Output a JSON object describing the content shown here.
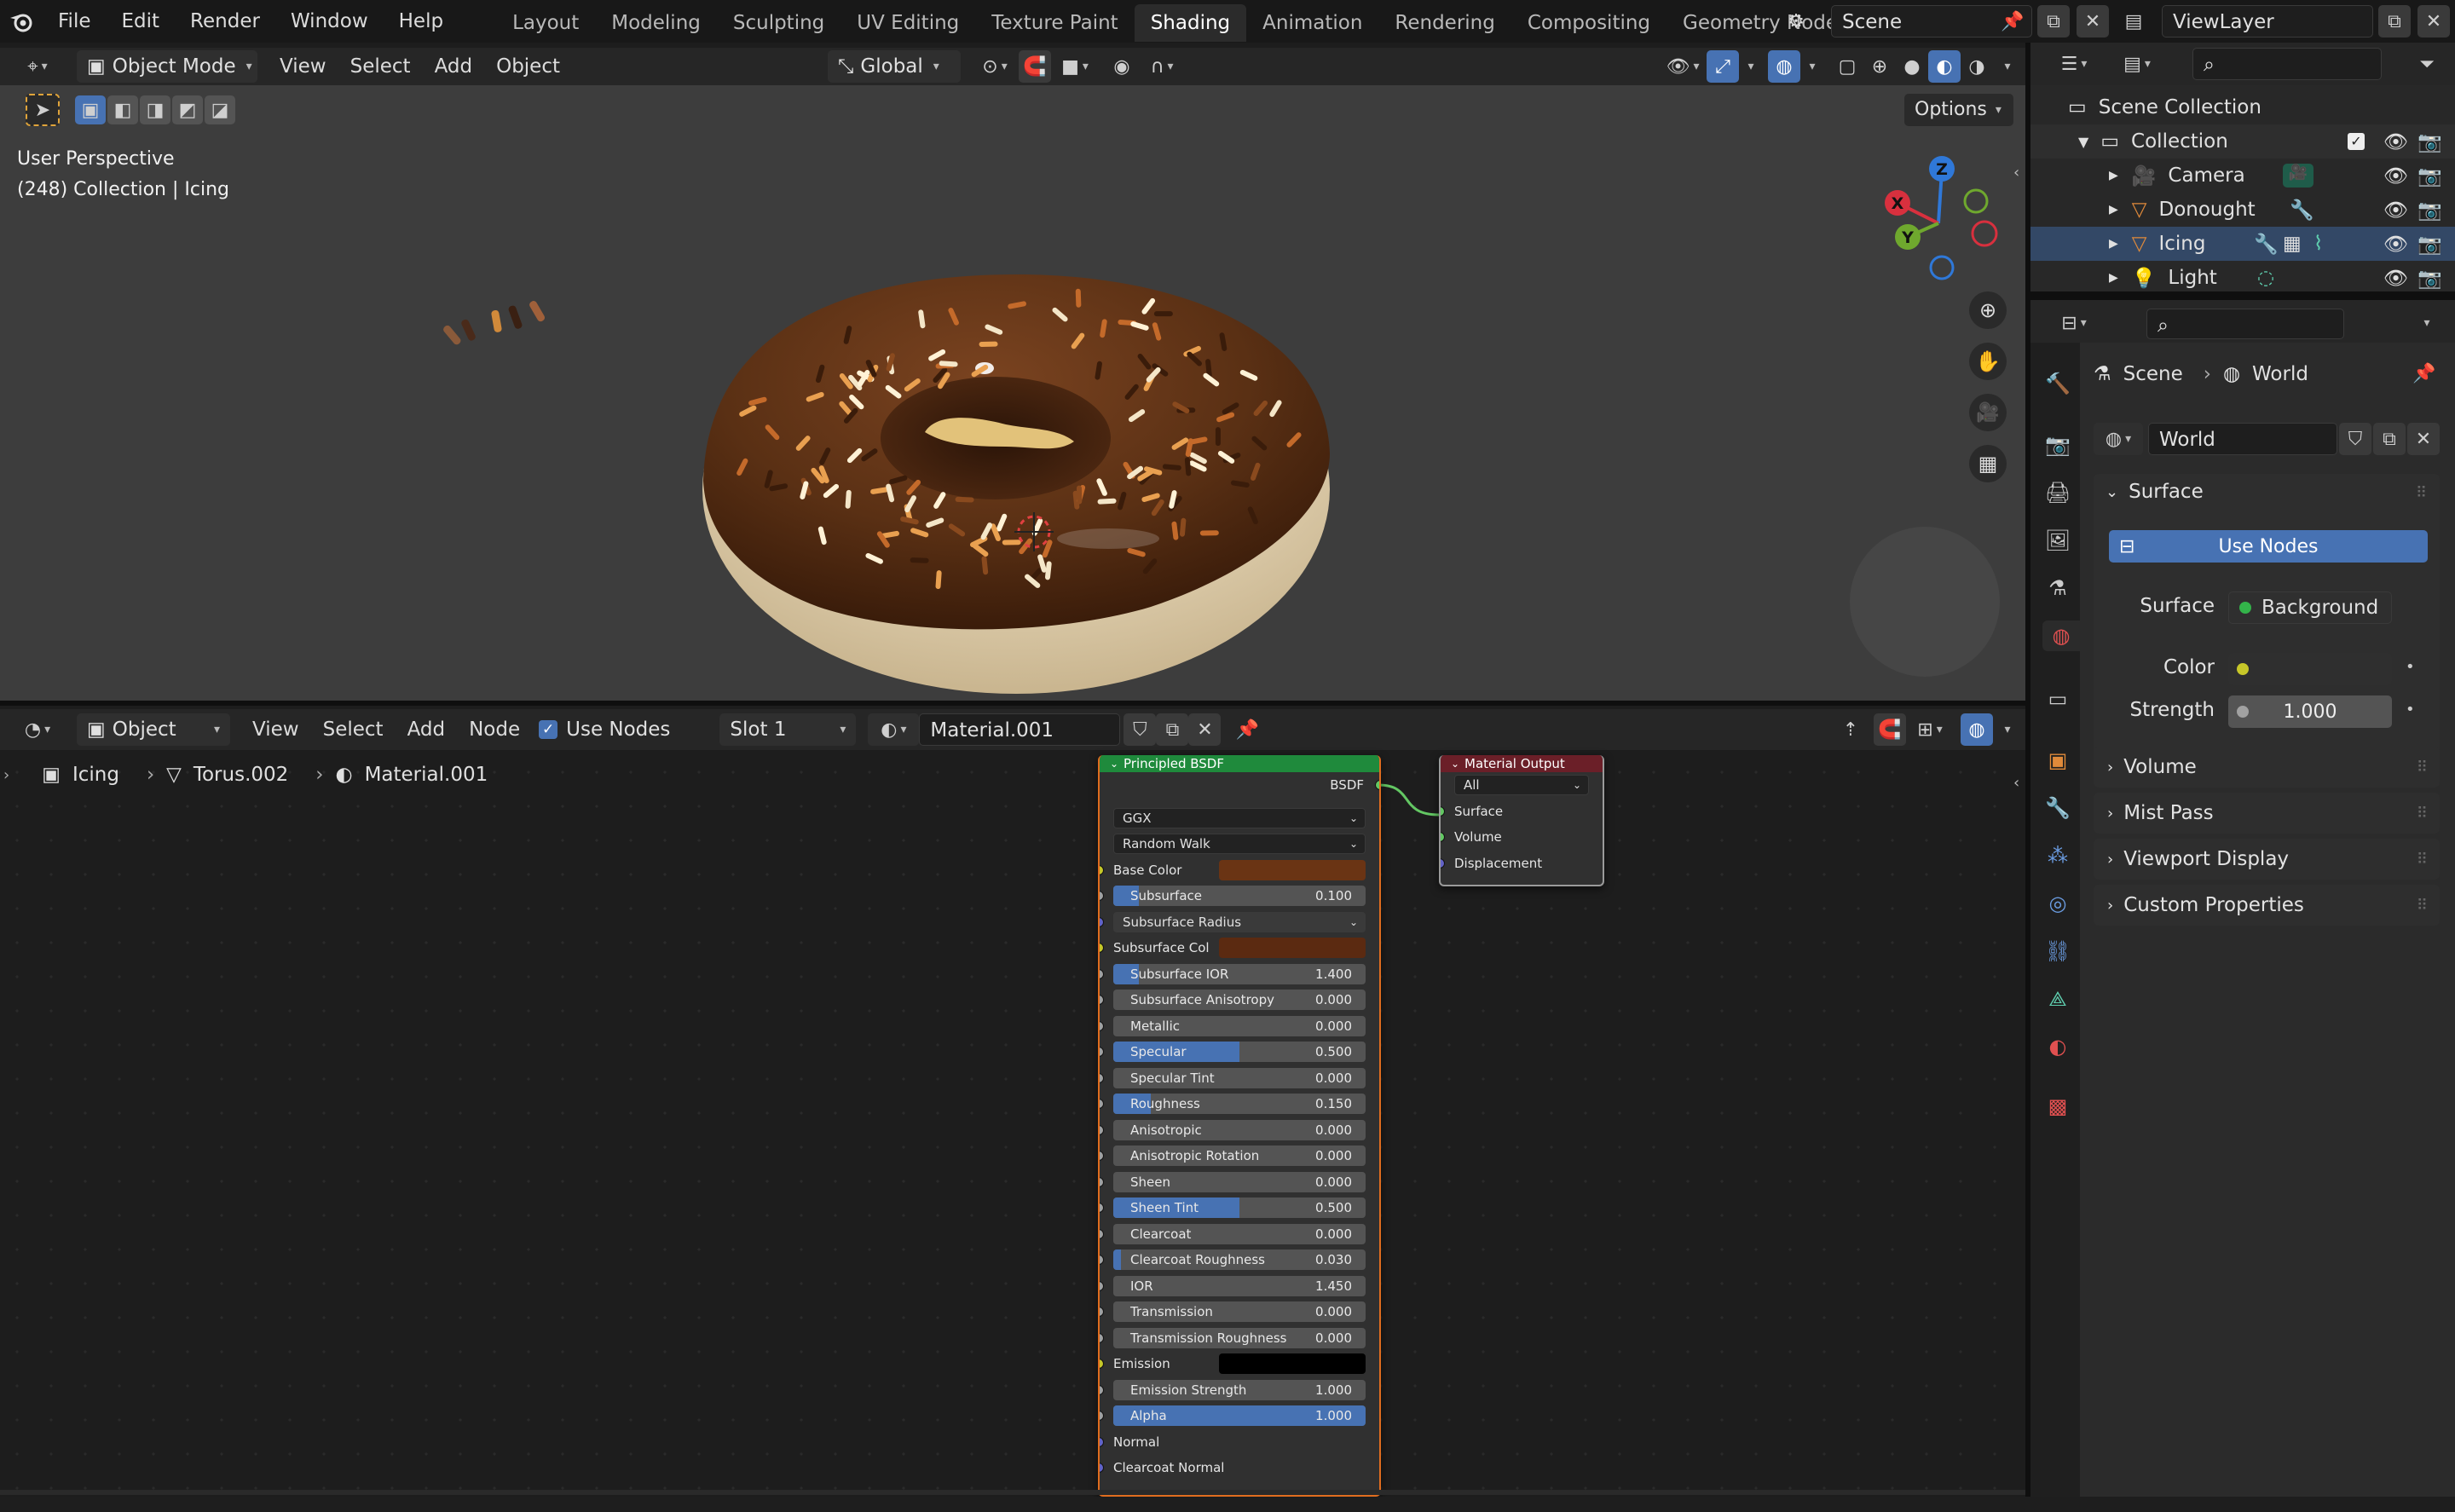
{
  "topbar": {
    "menus": [
      "File",
      "Edit",
      "Render",
      "Window",
      "Help"
    ],
    "workspaces": [
      "Layout",
      "Modeling",
      "Sculpting",
      "UV Editing",
      "Texture Paint",
      "Shading",
      "Animation",
      "Rendering",
      "Compositing",
      "Geometry Nodes"
    ],
    "active_workspace": "Shading",
    "scene_name": "Scene",
    "view_layer": "ViewLayer"
  },
  "viewport_header": {
    "mode": "Object Mode",
    "menus": [
      "View",
      "Select",
      "Add",
      "Object"
    ],
    "transform_orientation": "Global",
    "options_label": "Options"
  },
  "viewport": {
    "perspective_label": "User Perspective",
    "collection_label": "(248) Collection | Icing",
    "gizmo": {
      "x": "X",
      "y": "Y",
      "z": "Z"
    }
  },
  "node_header": {
    "editor_type": "Object",
    "menus": [
      "View",
      "Select",
      "Add",
      "Node"
    ],
    "use_nodes_label": "Use Nodes",
    "use_nodes_checked": true,
    "slot": "Slot 1",
    "material": "Material.001"
  },
  "breadcrumb": {
    "object": "Icing",
    "mesh": "Torus.002",
    "material": "Material.001"
  },
  "principled": {
    "title": "Principled BSDF",
    "output_label": "BSDF",
    "distribution": "GGX",
    "subsurface_method": "Random Walk",
    "base_color_label": "Base Color",
    "base_color": "#6a3414",
    "subsurface_radius_label": "Subsurface Radius",
    "subsurface_col_label": "Subsurface Col",
    "subsurface_col": "#5b2a11",
    "sliders_a": [
      {
        "label": "Subsurface",
        "value": "0.100",
        "fraction": 0.1
      }
    ],
    "sliders_b": [
      {
        "label": "Subsurface IOR",
        "value": "1.400",
        "fraction": 0.1
      },
      {
        "label": "Subsurface Anisotropy",
        "value": "0.000",
        "fraction": 0
      },
      {
        "label": "Metallic",
        "value": "0.000",
        "fraction": 0
      },
      {
        "label": "Specular",
        "value": "0.500",
        "fraction": 0.5
      },
      {
        "label": "Specular Tint",
        "value": "0.000",
        "fraction": 0
      },
      {
        "label": "Roughness",
        "value": "0.150",
        "fraction": 0.15
      },
      {
        "label": "Anisotropic",
        "value": "0.000",
        "fraction": 0
      },
      {
        "label": "Anisotropic Rotation",
        "value": "0.000",
        "fraction": 0
      },
      {
        "label": "Sheen",
        "value": "0.000",
        "fraction": 0
      },
      {
        "label": "Sheen Tint",
        "value": "0.500",
        "fraction": 0.5
      },
      {
        "label": "Clearcoat",
        "value": "0.000",
        "fraction": 0
      },
      {
        "label": "Clearcoat Roughness",
        "value": "0.030",
        "fraction": 0.03
      },
      {
        "label": "IOR",
        "value": "1.450",
        "fraction": 0
      },
      {
        "label": "Transmission",
        "value": "0.000",
        "fraction": 0
      },
      {
        "label": "Transmission Roughness",
        "value": "0.000",
        "fraction": 0
      }
    ],
    "emission_label": "Emission",
    "emission_color": "#000000",
    "sliders_c": [
      {
        "label": "Emission Strength",
        "value": "1.000",
        "fraction": 0
      },
      {
        "label": "Alpha",
        "value": "1.000",
        "fraction": 1
      }
    ],
    "normal_label": "Normal",
    "clearcoat_normal_label": "Clearcoat Normal"
  },
  "material_output": {
    "title": "Material Output",
    "target": "All",
    "inputs": [
      "Surface",
      "Volume",
      "Displacement"
    ]
  },
  "outliner": {
    "root": "Scene Collection",
    "collection": "Collection",
    "items": [
      "Camera",
      "Donought",
      "Icing",
      "Light"
    ]
  },
  "properties": {
    "breadcrumb_scene": "Scene",
    "breadcrumb_world": "World",
    "world_name": "World",
    "surface_panel": "Surface",
    "use_nodes_button": "Use Nodes",
    "surface_label": "Surface",
    "surface_value": "Background",
    "color_label": "Color",
    "strength_label": "Strength",
    "strength_value": "1.000",
    "collapsed_panels": [
      "Volume",
      "Mist Pass",
      "Viewport Display",
      "Custom Properties"
    ]
  },
  "colors": {
    "accent": "#4772b3",
    "node_header_shader": "#1f8a3c",
    "node_header_output": "#6b1f28",
    "donut_icing": "#5a3014",
    "donut_dough": "#e9d8b4"
  }
}
